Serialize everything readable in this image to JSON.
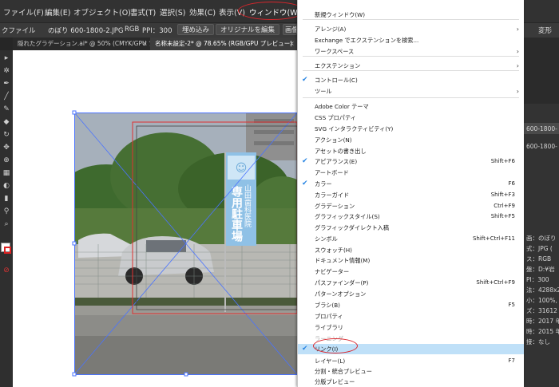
{
  "menubar": {
    "items": [
      "ファイル(F)",
      "編集(E)",
      "オブジェクト(O)",
      "書式(T)",
      "選択(S)",
      "効果(C)",
      "表示(V)",
      "ウィンドウ(W)"
    ]
  },
  "controlbar": {
    "left_label": "クファイル",
    "filename": "のぼり 600-1800-2.JPG",
    "colormode": "RGB",
    "ppi": "PPI：300",
    "embed_button": "埋め込み",
    "edit_original_button": "オリジナルを編集",
    "image_button": "画像",
    "right_label": "変形"
  },
  "tabs": [
    {
      "label": "隠れたグラデーション.ai* @ 50% (CMYK/GPU プレビュー)",
      "close": "×"
    },
    {
      "label": "名称未設定-2* @ 78.65% (RGB/GPU プレビュー)",
      "close": "×"
    }
  ],
  "banner": {
    "text1": "山田歯科医院",
    "text2": "専用駐車場"
  },
  "window_menu": {
    "items": [
      {
        "label": "新規ウィンドウ(W)",
        "shortcut": "",
        "checked": false,
        "submenu": false
      },
      {
        "label": "アレンジ(A)",
        "shortcut": "",
        "checked": false,
        "submenu": true
      },
      {
        "label": "Exchange でエクステンションを検索...",
        "shortcut": "",
        "checked": false,
        "submenu": false
      },
      {
        "label": "ワークスペース",
        "shortcut": "",
        "checked": false,
        "submenu": true
      },
      {
        "label": "エクステンション",
        "shortcut": "",
        "checked": false,
        "submenu": true
      },
      {
        "label": "コントロール(C)",
        "shortcut": "",
        "checked": true,
        "submenu": false
      },
      {
        "label": "ツール",
        "shortcut": "",
        "checked": false,
        "submenu": true
      },
      {
        "label": "Adobe Color テーマ",
        "shortcut": "",
        "checked": false,
        "submenu": false
      },
      {
        "label": "CSS プロパティ",
        "shortcut": "",
        "checked": false,
        "submenu": false
      },
      {
        "label": "SVG インタラクティビティ(Y)",
        "shortcut": "",
        "checked": false,
        "submenu": false
      },
      {
        "label": "アクション(N)",
        "shortcut": "",
        "checked": false,
        "submenu": false
      },
      {
        "label": "アセットの書き出し",
        "shortcut": "",
        "checked": false,
        "submenu": false
      },
      {
        "label": "アピアランス(E)",
        "shortcut": "Shift+F6",
        "checked": true,
        "submenu": false
      },
      {
        "label": "アートボード",
        "shortcut": "",
        "checked": false,
        "submenu": false
      },
      {
        "label": "カラー",
        "shortcut": "F6",
        "checked": true,
        "submenu": false
      },
      {
        "label": "カラーガイド",
        "shortcut": "Shift+F3",
        "checked": false,
        "submenu": false
      },
      {
        "label": "グラデーション",
        "shortcut": "Ctrl+F9",
        "checked": false,
        "submenu": false
      },
      {
        "label": "グラフィックスタイル(S)",
        "shortcut": "Shift+F5",
        "checked": false,
        "submenu": false
      },
      {
        "label": "グラフィックダイレクト入稿",
        "shortcut": "",
        "checked": false,
        "submenu": false
      },
      {
        "label": "シンボル",
        "shortcut": "Shift+Ctrl+F11",
        "checked": false,
        "submenu": false
      },
      {
        "label": "スウォッチ(H)",
        "shortcut": "",
        "checked": false,
        "submenu": false
      },
      {
        "label": "ドキュメント情報(M)",
        "shortcut": "",
        "checked": false,
        "submenu": false
      },
      {
        "label": "ナビゲーター",
        "shortcut": "",
        "checked": false,
        "submenu": false
      },
      {
        "label": "パスファインダー(P)",
        "shortcut": "Shift+Ctrl+F9",
        "checked": false,
        "submenu": false
      },
      {
        "label": "パターンオプション",
        "shortcut": "",
        "checked": false,
        "submenu": false
      },
      {
        "label": "ブラシ(B)",
        "shortcut": "F5",
        "checked": false,
        "submenu": false
      },
      {
        "label": "プロパティ",
        "shortcut": "",
        "checked": false,
        "submenu": false
      },
      {
        "label": "ライブラリ",
        "shortcut": "",
        "checked": false,
        "submenu": false
      },
      {
        "label": "ラーニング",
        "shortcut": "",
        "checked": false,
        "submenu": false,
        "disabled": true
      },
      {
        "label": "リンク(I)",
        "shortcut": "",
        "checked": true,
        "submenu": false,
        "highlight": true
      },
      {
        "label": "レイヤー(L)",
        "shortcut": "F7",
        "checked": false,
        "submenu": false
      },
      {
        "label": "分割・統合プレビュー",
        "shortcut": "",
        "checked": false,
        "submenu": false
      },
      {
        "label": "分版プレビュー",
        "shortcut": "",
        "checked": false,
        "submenu": false
      }
    ]
  },
  "right_panel": {
    "rows": [
      "600-1800-",
      "600-1800-",
      "画：のぼり",
      "式：JPG (",
      "ス：RGB",
      "盤：D:¥岩",
      "PI：300",
      "法：4288x2",
      "小：100%,",
      "ズ：31612",
      "時：2017 年",
      "時：2015 年",
      "接：なし"
    ]
  },
  "colors": {
    "menubar_bg": "#323232",
    "menu_bg": "#ffffff",
    "highlight": "#bfe0f8",
    "check": "#2a86e3",
    "annotation_red": "#d9262c"
  }
}
